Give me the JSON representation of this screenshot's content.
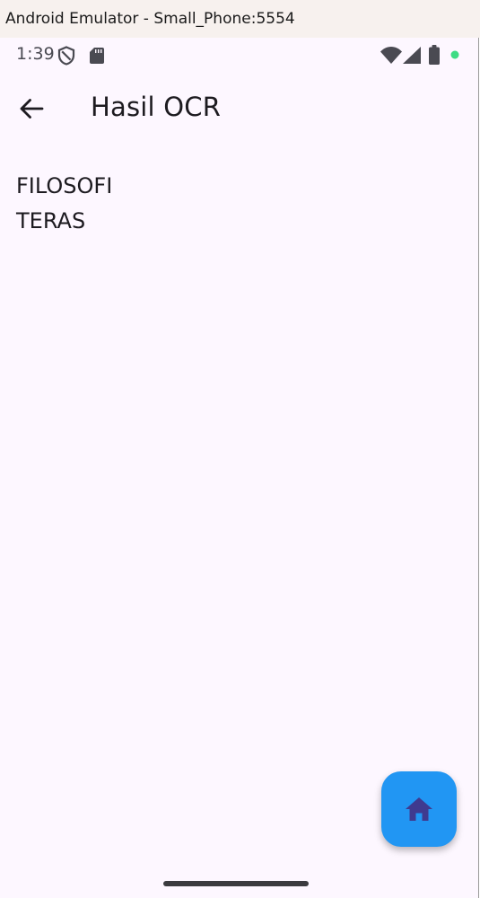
{
  "window": {
    "title": "Android Emulator - Small_Phone:5554"
  },
  "status_bar": {
    "time": "1:39",
    "left_icons": [
      "shield-icon",
      "sd-card-icon"
    ],
    "right_icons": [
      "wifi-icon",
      "cellular-signal-icon",
      "battery-icon",
      "active-dot-icon"
    ]
  },
  "app_bar": {
    "title": "Hasil OCR",
    "back_icon": "arrow-left-icon"
  },
  "content": {
    "ocr_lines": [
      "FILOSOFI",
      "TERAS"
    ]
  },
  "fab": {
    "icon": "home-icon"
  },
  "colors": {
    "background": "#fdf7ff",
    "fab": "#2196f3",
    "fab_icon": "#3f3a8f",
    "text": "#1d1b20",
    "status_dot": "#3ddc84"
  }
}
